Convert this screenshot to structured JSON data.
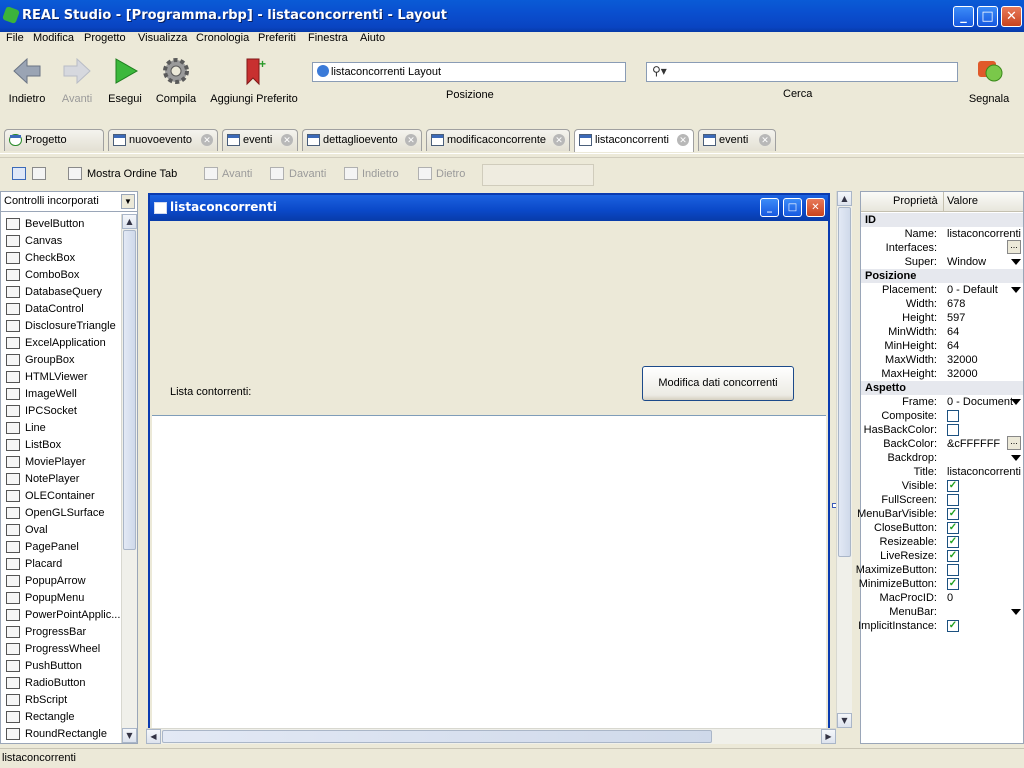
{
  "window": {
    "title": "REAL Studio - [Programma.rbp] - listaconcorrenti - Layout"
  },
  "menu": [
    "File",
    "Modifica",
    "Progetto",
    "Visualizza",
    "Cronologia",
    "Preferiti",
    "Finestra",
    "Aiuto"
  ],
  "toolbar": {
    "back": "Indietro",
    "forward": "Avanti",
    "run": "Esegui",
    "build": "Compila",
    "bookmark": "Aggiungi Preferito",
    "location_value": "listaconcorrenti Layout",
    "location_label": "Posizione",
    "search_value": "",
    "search_label": "Cerca",
    "report": "Segnala"
  },
  "tabs": [
    {
      "label": "Progetto"
    },
    {
      "label": "nuovoevento"
    },
    {
      "label": "eventi"
    },
    {
      "label": "dettaglioevento"
    },
    {
      "label": "modificaconcorrente"
    },
    {
      "label": "listaconcorrenti"
    },
    {
      "label": "eventi"
    }
  ],
  "layout_toolbar": {
    "show_tab_order": "Mostra Ordine Tab",
    "forward": "Avanti",
    "front": "Davanti",
    "backward": "Indietro",
    "back": "Dietro"
  },
  "controls": {
    "filter": "Controlli incorporati",
    "items": [
      "BevelButton",
      "Canvas",
      "CheckBox",
      "ComboBox",
      "DatabaseQuery",
      "DataControl",
      "DisclosureTriangle",
      "ExcelApplication",
      "GroupBox",
      "HTMLViewer",
      "ImageWell",
      "IPCSocket",
      "Line",
      "ListBox",
      "MoviePlayer",
      "NotePlayer",
      "OLEContainer",
      "OpenGLSurface",
      "Oval",
      "PagePanel",
      "Placard",
      "PopupArrow",
      "PopupMenu",
      "PowerPointApplic...",
      "ProgressBar",
      "ProgressWheel",
      "PushButton",
      "RadioButton",
      "RbScript",
      "Rectangle",
      "RoundRectangle"
    ]
  },
  "editor_window": {
    "title": "listaconcorrenti",
    "label": "Lista contorrenti:",
    "button": "Modifica dati concorrenti"
  },
  "properties": {
    "header_name": "Proprietà",
    "header_value": "Valore",
    "rows": [
      {
        "group": "ID"
      },
      {
        "name": "Name:",
        "value": "listaconcorrenti"
      },
      {
        "name": "Interfaces:",
        "value": "",
        "ellipsis": true
      },
      {
        "name": "Super:",
        "value": "Window",
        "dropdown": true
      },
      {
        "group": "Posizione"
      },
      {
        "name": "Placement:",
        "value": "0 - Default",
        "dropdown": true
      },
      {
        "name": "Width:",
        "value": "678"
      },
      {
        "name": "Height:",
        "value": "597"
      },
      {
        "name": "MinWidth:",
        "value": "64"
      },
      {
        "name": "MinHeight:",
        "value": "64"
      },
      {
        "name": "MaxWidth:",
        "value": "32000"
      },
      {
        "name": "MaxHeight:",
        "value": "32000"
      },
      {
        "group": "Aspetto"
      },
      {
        "name": "Frame:",
        "value": "0 - Document",
        "dropdown": true
      },
      {
        "name": "Composite:",
        "check": false
      },
      {
        "name": "HasBackColor:",
        "check": false
      },
      {
        "name": "BackColor:",
        "value": "&cFFFFFF",
        "ellipsis": true
      },
      {
        "name": "Backdrop:",
        "value": "",
        "dropdown": true
      },
      {
        "name": "Title:",
        "value": "listaconcorrenti"
      },
      {
        "name": "Visible:",
        "check": true
      },
      {
        "name": "FullScreen:",
        "check": false
      },
      {
        "name": "MenuBarVisible:",
        "check": true
      },
      {
        "name": "CloseButton:",
        "check": true
      },
      {
        "name": "Resizeable:",
        "check": true
      },
      {
        "name": "LiveResize:",
        "check": true
      },
      {
        "name": "MaximizeButton:",
        "check": false
      },
      {
        "name": "MinimizeButton:",
        "check": true
      },
      {
        "name": "MacProcID:",
        "value": "0"
      },
      {
        "name": "MenuBar:",
        "value": "",
        "dropdown": true
      },
      {
        "name": "ImplicitInstance:",
        "check": true
      }
    ]
  },
  "status": {
    "text": "listaconcorrenti"
  },
  "colors": {
    "title_bar": "#0a4fcf",
    "chrome": "#ece9d8",
    "accent": "#3c6ab8"
  }
}
